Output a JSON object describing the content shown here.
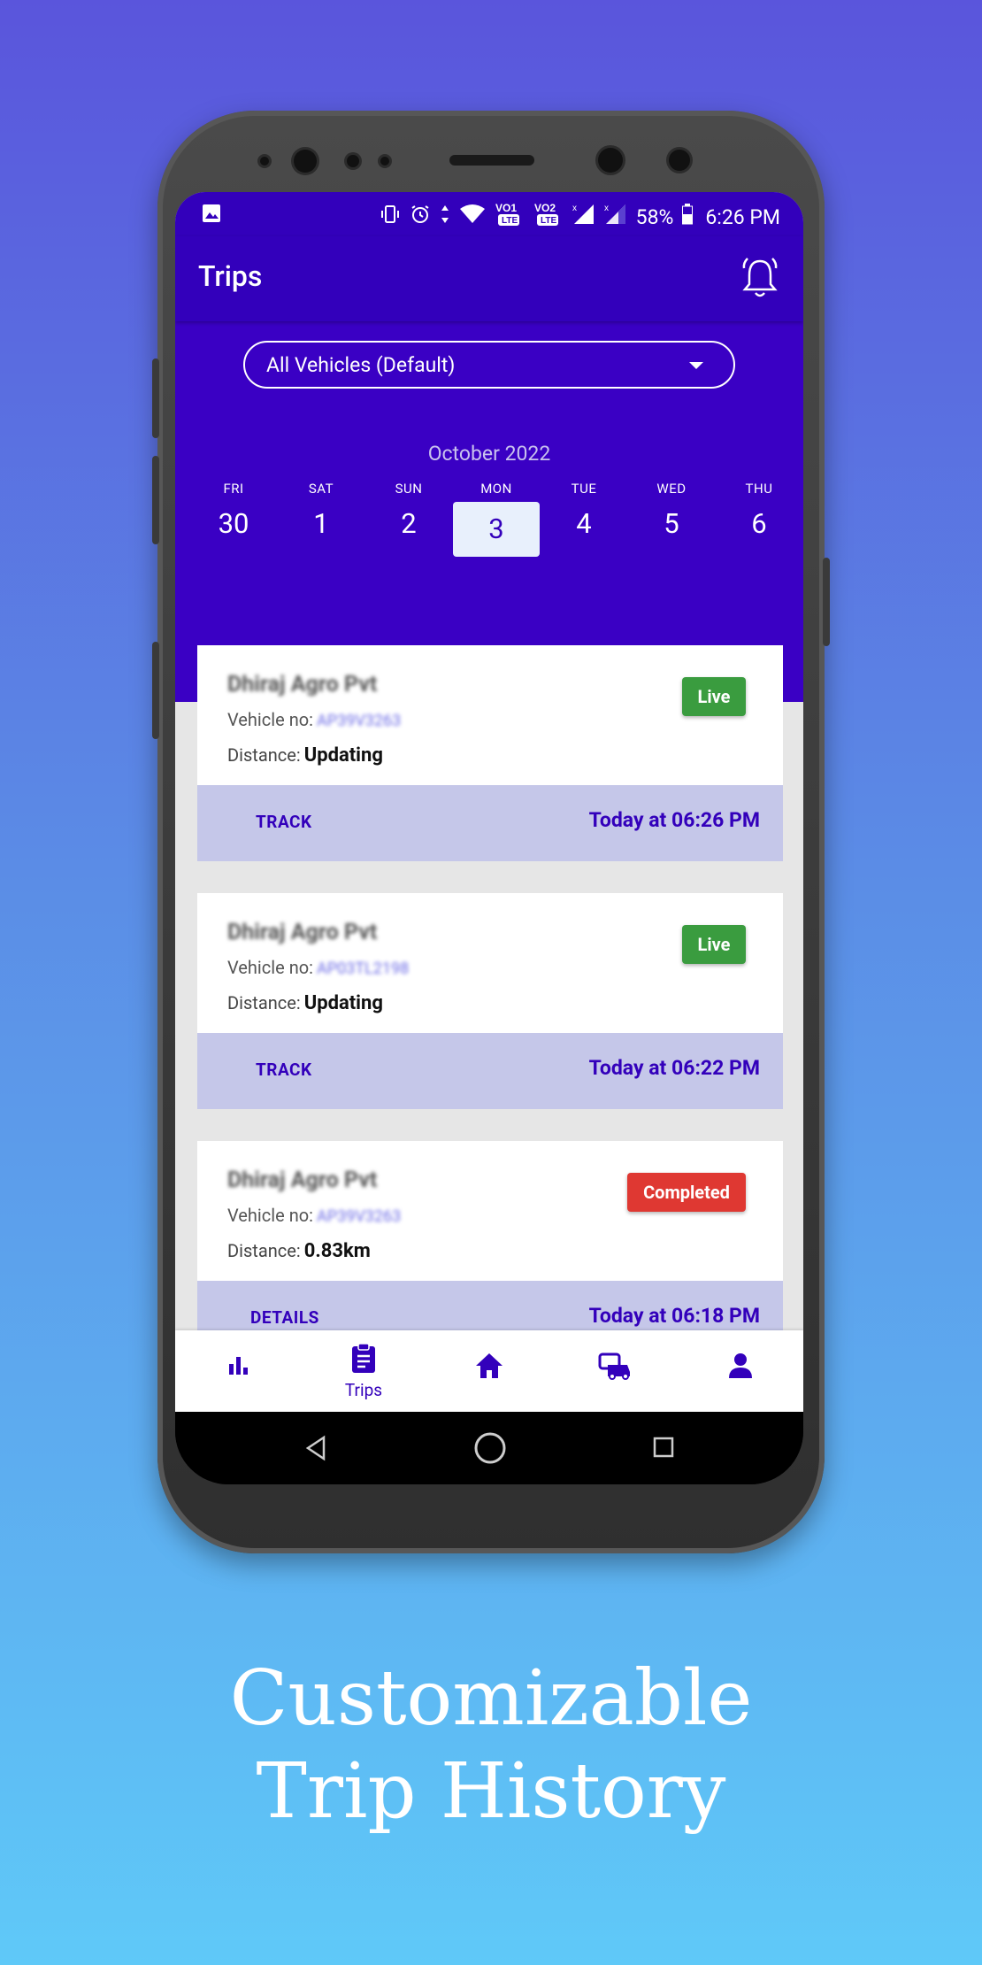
{
  "status_bar": {
    "battery": "58%",
    "time": "6:26 PM"
  },
  "toolbar": {
    "title": "Trips"
  },
  "vehicle_filter": {
    "selected": "All Vehicles (Default)"
  },
  "calendar": {
    "month": "October 2022",
    "days": [
      {
        "name": "FRI",
        "num": "30"
      },
      {
        "name": "SAT",
        "num": "1"
      },
      {
        "name": "SUN",
        "num": "2"
      },
      {
        "name": "MON",
        "num": "3",
        "selected": true
      },
      {
        "name": "TUE",
        "num": "4"
      },
      {
        "name": "WED",
        "num": "5"
      },
      {
        "name": "THU",
        "num": "6"
      }
    ]
  },
  "labels": {
    "vehicle_no": "Vehicle no:",
    "distance": "Distance:"
  },
  "trips": [
    {
      "company": "Dhiraj Agro Pvt",
      "vehicle": "AP39V3263",
      "distance": "Updating",
      "status": "Live",
      "action": "TRACK",
      "time": "Today at 06:26 PM"
    },
    {
      "company": "Dhiraj Agro Pvt",
      "vehicle": "AP03TL2198",
      "distance": "Updating",
      "status": "Live",
      "action": "TRACK",
      "time": "Today at 06:22 PM"
    },
    {
      "company": "Dhiraj Agro Pvt",
      "vehicle": "AP39V3263",
      "distance": "0.83km",
      "status": "Completed",
      "action": "DETAILS",
      "time": "Today at 06:18 PM"
    }
  ],
  "bottom_nav": {
    "active_label": "Trips"
  },
  "caption": {
    "line1": "Customizable",
    "line2": "Trip History"
  },
  "colors": {
    "primary": "#3300bb",
    "live": "#3a9c3f",
    "completed": "#df3832"
  }
}
